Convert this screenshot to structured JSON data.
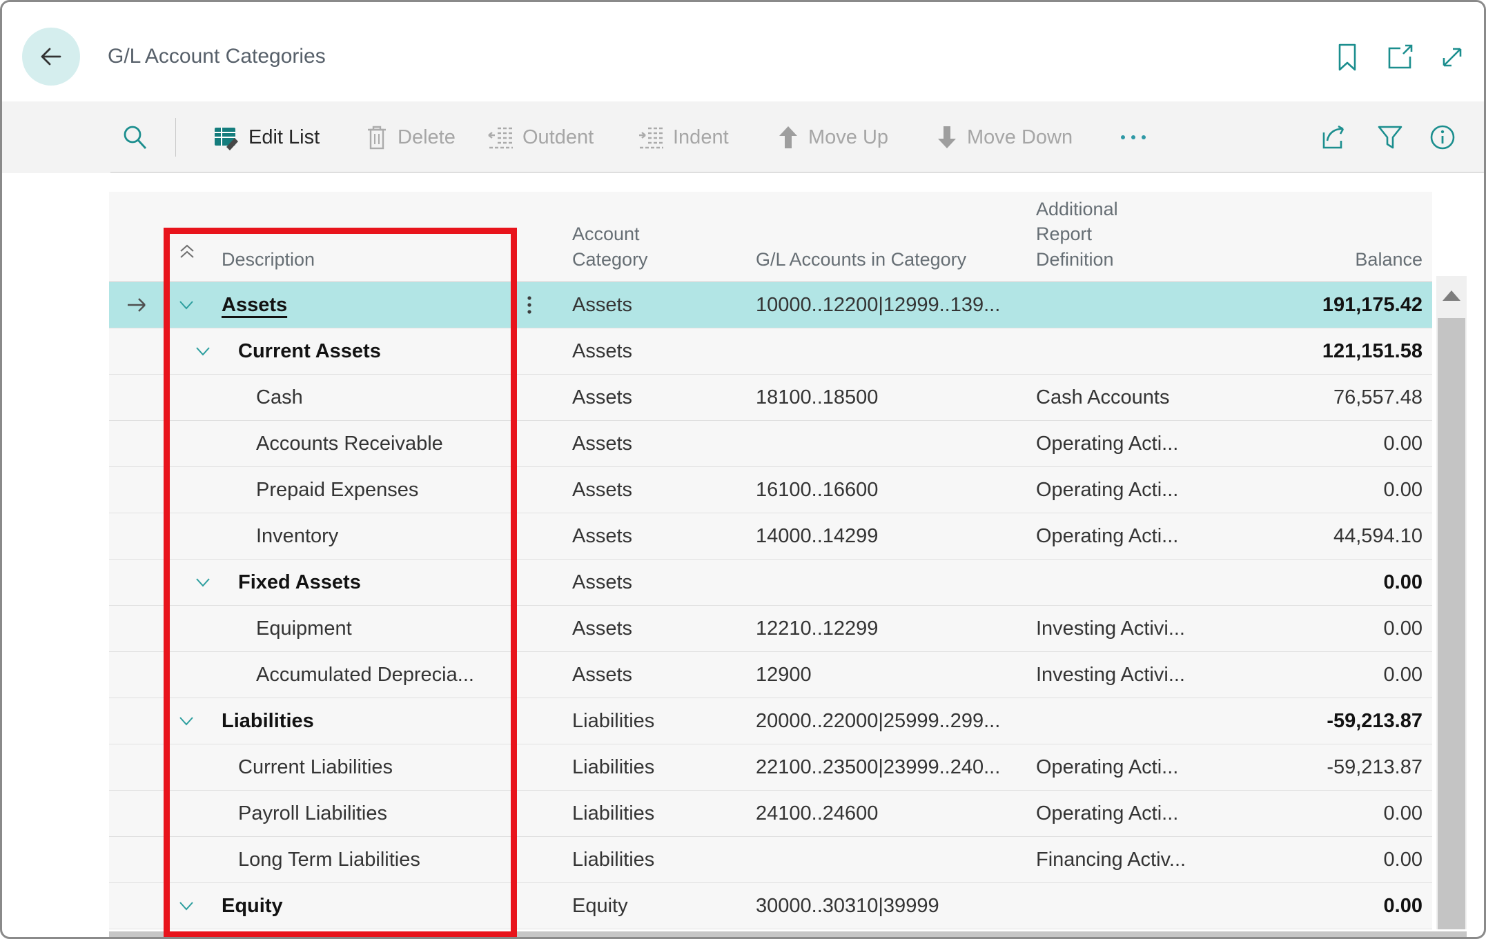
{
  "window": {
    "title": "G/L Account Categories"
  },
  "toolbar": {
    "items": [
      {
        "label": "Edit List",
        "enabled": true
      },
      {
        "label": "Delete",
        "enabled": false
      },
      {
        "label": "Outdent",
        "enabled": false
      },
      {
        "label": "Indent",
        "enabled": false
      },
      {
        "label": "Move Up",
        "enabled": false
      },
      {
        "label": "Move Down",
        "enabled": false
      }
    ],
    "more_label": "..."
  },
  "table": {
    "headers": {
      "description": "Description",
      "account_category": "Account Category",
      "gl_accounts": "G/L Accounts in Category",
      "additional_report_definition": "Additional Report Definition",
      "balance": "Balance"
    },
    "rows": [
      {
        "description": "Assets",
        "account_category": "Assets",
        "gl_accounts": "10000..12200|12999..139...",
        "additional_report_definition": "",
        "balance": "191,175.42",
        "level": 0,
        "bold": true,
        "selected": true
      },
      {
        "description": "Current Assets",
        "account_category": "Assets",
        "gl_accounts": "",
        "additional_report_definition": "",
        "balance": "121,151.58",
        "level": 1,
        "bold": true,
        "selected": false
      },
      {
        "description": "Cash",
        "account_category": "Assets",
        "gl_accounts": "18100..18500",
        "additional_report_definition": "Cash Accounts",
        "balance": "76,557.48",
        "level": 2,
        "bold": false,
        "selected": false
      },
      {
        "description": "Accounts Receivable",
        "account_category": "Assets",
        "gl_accounts": "",
        "additional_report_definition": "Operating Acti...",
        "balance": "0.00",
        "level": 2,
        "bold": false,
        "selected": false
      },
      {
        "description": "Prepaid Expenses",
        "account_category": "Assets",
        "gl_accounts": "16100..16600",
        "additional_report_definition": "Operating Acti...",
        "balance": "0.00",
        "level": 2,
        "bold": false,
        "selected": false
      },
      {
        "description": "Inventory",
        "account_category": "Assets",
        "gl_accounts": "14000..14299",
        "additional_report_definition": "Operating Acti...",
        "balance": "44,594.10",
        "level": 2,
        "bold": false,
        "selected": false
      },
      {
        "description": "Fixed Assets",
        "account_category": "Assets",
        "gl_accounts": "",
        "additional_report_definition": "",
        "balance": "0.00",
        "level": 1,
        "bold": true,
        "selected": false
      },
      {
        "description": "Equipment",
        "account_category": "Assets",
        "gl_accounts": "12210..12299",
        "additional_report_definition": "Investing Activi...",
        "balance": "0.00",
        "level": 2,
        "bold": false,
        "selected": false
      },
      {
        "description": "Accumulated Deprecia...",
        "account_category": "Assets",
        "gl_accounts": "12900",
        "additional_report_definition": "Investing Activi...",
        "balance": "0.00",
        "level": 2,
        "bold": false,
        "selected": false
      },
      {
        "description": "Liabilities",
        "account_category": "Liabilities",
        "gl_accounts": "20000..22000|25999..299...",
        "additional_report_definition": "",
        "balance": "-59,213.87",
        "level": 0,
        "bold": true,
        "selected": false
      },
      {
        "description": "Current Liabilities",
        "account_category": "Liabilities",
        "gl_accounts": "22100..23500|23999..240...",
        "additional_report_definition": "Operating Acti...",
        "balance": "-59,213.87",
        "level": 1,
        "bold": false,
        "selected": false
      },
      {
        "description": "Payroll Liabilities",
        "account_category": "Liabilities",
        "gl_accounts": "24100..24600",
        "additional_report_definition": "Operating Acti...",
        "balance": "0.00",
        "level": 1,
        "bold": false,
        "selected": false
      },
      {
        "description": "Long Term Liabilities",
        "account_category": "Liabilities",
        "gl_accounts": "",
        "additional_report_definition": "Financing Activ...",
        "balance": "0.00",
        "level": 1,
        "bold": false,
        "selected": false
      },
      {
        "description": "Equity",
        "account_category": "Equity",
        "gl_accounts": "30000..30310|39999",
        "additional_report_definition": "",
        "balance": "0.00",
        "level": 0,
        "bold": true,
        "selected": false
      }
    ]
  },
  "icons": [
    "back-icon",
    "bookmark-icon",
    "open-in-new-window-icon",
    "expand-icon",
    "search-icon",
    "edit-list-icon",
    "delete-icon",
    "outdent-icon",
    "indent-icon",
    "move-up-icon",
    "move-down-icon",
    "more-icon",
    "share-icon",
    "filter-icon",
    "info-icon",
    "collapse-all-icon",
    "chevron-down-icon",
    "row-selector-arrow-icon",
    "row-ellipsis-icon",
    "scroll-up-icon"
  ],
  "colors": {
    "accent_teal": "#1b8e8e",
    "selected_row": "#b2e5e5",
    "annotation_red": "#e8141c",
    "toolbar_bg": "#f3f3f3"
  }
}
